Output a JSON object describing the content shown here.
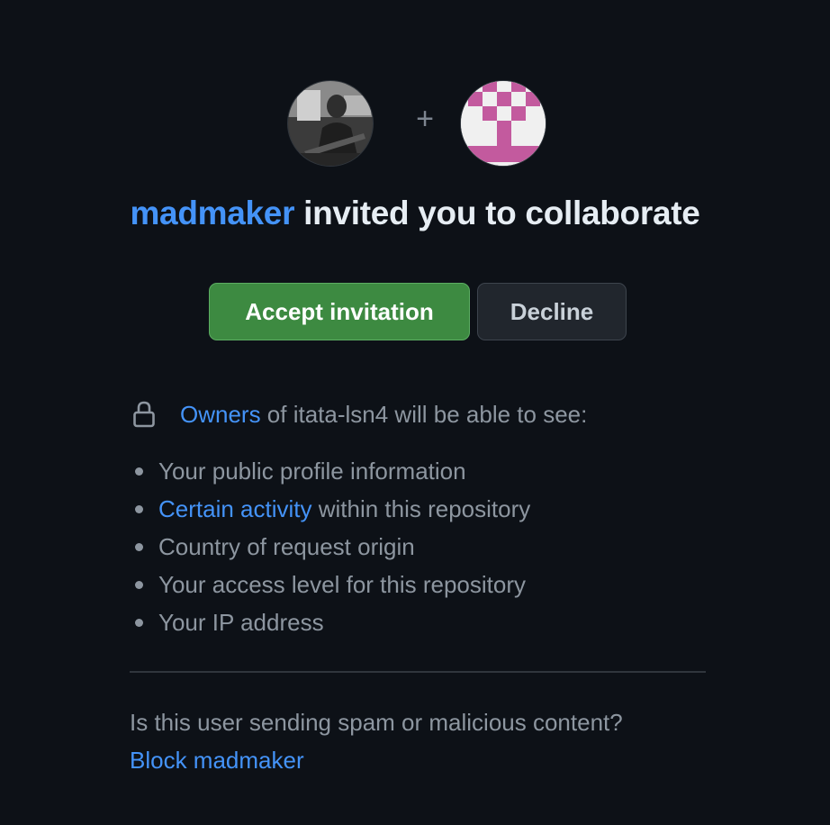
{
  "invite": {
    "plus_sign": "+",
    "inviter": "madmaker",
    "heading_rest": " invited you to collaborate",
    "accept_label": "Accept invitation",
    "decline_label": "Decline"
  },
  "visibility": {
    "owners_link": "Owners",
    "owners_rest": " of itata-lsn4 will be able to see:",
    "items": [
      {
        "text": "Your public profile information"
      },
      {
        "link": "Certain activity",
        "text": " within this repository"
      },
      {
        "text": "Country of request origin"
      },
      {
        "text": "Your access level for this repository"
      },
      {
        "text": "Your IP address"
      }
    ]
  },
  "spam": {
    "question": "Is this user sending spam or malicious content?",
    "block_label": "Block madmaker"
  },
  "icons": {
    "lock": "lock-icon",
    "inviter_avatar": "user-avatar",
    "repo_avatar": "identicon-avatar"
  },
  "colors": {
    "background": "#0d1117",
    "link": "#4493f8",
    "accept_button": "#3d8a41",
    "decline_button": "#21262d",
    "muted_text": "#8d96a0",
    "identicon": "#c35a9e"
  }
}
